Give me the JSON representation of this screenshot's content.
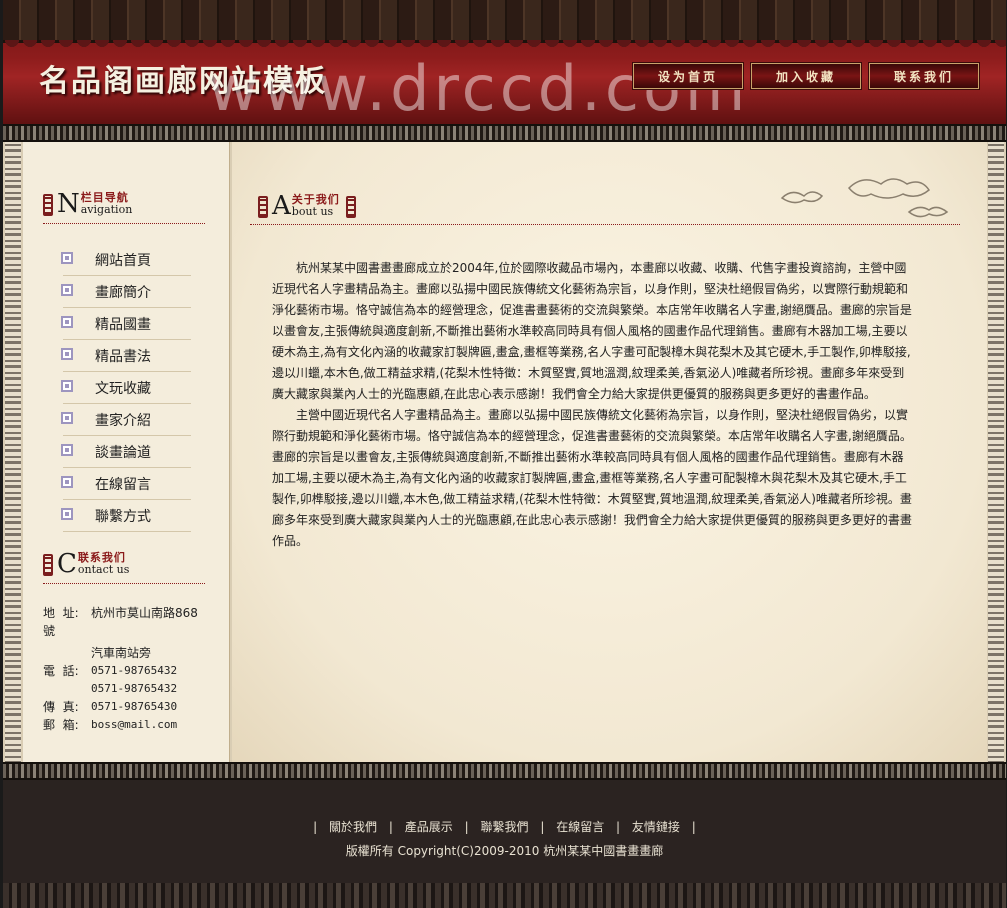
{
  "header": {
    "title": "名品阁画廊网站模板",
    "watermark": "www.drccd.com",
    "buttons": [
      "设为首页",
      "加入收藏",
      "联系我们"
    ]
  },
  "sidebar": {
    "nav_head": {
      "letter": "N",
      "cn": "栏目导航",
      "en": "avigation"
    },
    "nav_items": [
      "網站首頁",
      "畫廊簡介",
      "精品國畫",
      "精品書法",
      "文玩收藏",
      "畫家介紹",
      "談畫論道",
      "在線留言",
      "聯繫方式"
    ],
    "contact_head": {
      "letter": "C",
      "cn": "联系我们",
      "en": "ontact us"
    },
    "contact": {
      "addr_label": "地  址:",
      "addr_1": "杭州市莫山南路868",
      "addr_2": "號",
      "addr_3": "汽車南站旁",
      "tel_label": "電  話:",
      "tel_1": "0571-98765432",
      "tel_2": "0571-98765432",
      "fax_label": "傳  真:",
      "fax": "0571-98765430",
      "mail_label": "郵  箱:",
      "mail": "boss@mail.com"
    }
  },
  "content": {
    "head": {
      "letter": "A",
      "cn": "关于我们",
      "en": "bout us"
    },
    "paragraphs": [
      "杭州某某中國書畫畫廊成立於2004年,位於國際收藏品市場內，本畫廊以收藏、收購、代售字畫投資諮詢，主營中國近現代名人字畫精品為主。畫廊以弘揚中國民族傳統文化藝術為宗旨，以身作則，堅決杜絕假冒偽劣，以實際行動規範和淨化藝術市場。恪守誠信為本的經營理念，促進書畫藝術的交流與繁榮。本店常年收購名人字畫,謝絕贋品。畫廊的宗旨是以畫會友,主張傳統與適度創新,不斷推出藝術水準較高同時具有個人風格的國畫作品代理銷售。畫廊有木器加工場,主要以硬木為主,為有文化內涵的收藏家訂製牌匾,畫盒,畫框等業務,名人字畫可配製樟木與花梨木及其它硬木,手工製作,卯榫駁接,邊以川蠟,本木色,做工精益求精,(花梨木性特徵：木質堅實,質地溫潤,紋理柔美,香氣泌人)唯藏者所珍視。畫廊多年來受到廣大藏家與業內人士的光臨惠顧,在此忠心表示感謝！我們會全力給大家提供更優質的服務與更多更好的書畫作品。",
      "主營中國近現代名人字畫精品為主。畫廊以弘揚中國民族傳統文化藝術為宗旨，以身作則，堅決杜絕假冒偽劣，以實際行動規範和淨化藝術市場。恪守誠信為本的經營理念，促進書畫藝術的交流與繁榮。本店常年收購名人字畫,謝絕贋品。畫廊的宗旨是以畫會友,主張傳統與適度創新,不斷推出藝術水準較高同時具有個人風格的國畫作品代理銷售。畫廊有木器加工場,主要以硬木為主,為有文化內涵的收藏家訂製牌匾,畫盒,畫框等業務,名人字畫可配製樟木與花梨木及其它硬木,手工製作,卯榫駁接,邊以川蠟,本木色,做工精益求精,(花梨木性特徵：木質堅實,質地溫潤,紋理柔美,香氣泌人)唯藏者所珍視。畫廊多年來受到廣大藏家與業內人士的光臨惠顧,在此忠心表示感謝！我們會全力給大家提供更優質的服務與更多更好的書畫作品。"
    ]
  },
  "footer": {
    "links": [
      "關於我們",
      "產品展示",
      "聯繫我們",
      "在線留言",
      "友情鏈接"
    ],
    "separator": "|",
    "copyright": "版權所有 Copyright(C)2009-2010 杭州某某中國書畫畫廊"
  },
  "colors": {
    "accent_red": "#8b1a1a",
    "header_red": "#8d1c1c",
    "footer_bg": "#2b2321"
  }
}
